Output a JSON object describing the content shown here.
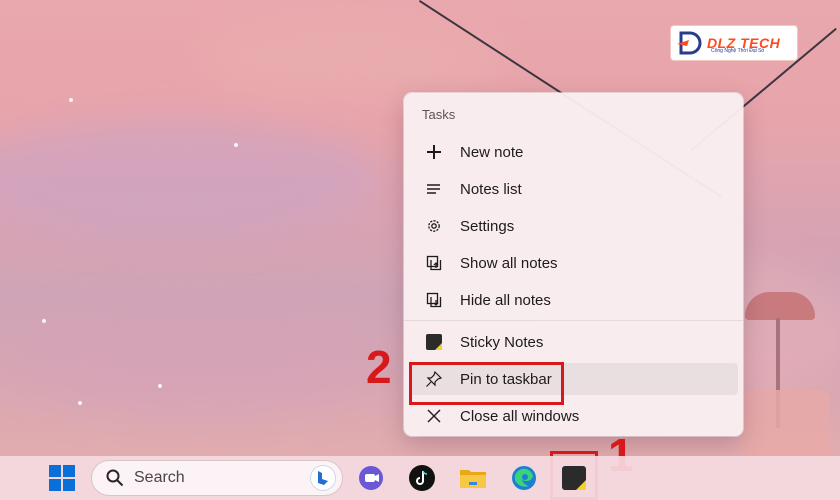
{
  "watermark": {
    "brand": "DLZ TECH",
    "tagline": "Công Nghệ Thời Đại Số"
  },
  "menu": {
    "header": "Tasks",
    "items": [
      {
        "label": "New note",
        "icon": "plus-icon"
      },
      {
        "label": "Notes list",
        "icon": "list-icon"
      },
      {
        "label": "Settings",
        "icon": "gear-icon"
      },
      {
        "label": "Show all notes",
        "icon": "show-windows-icon"
      },
      {
        "label": "Hide all notes",
        "icon": "hide-windows-icon"
      },
      {
        "label": "Sticky Notes",
        "icon": "sticky-notes-app-icon"
      },
      {
        "label": "Pin to taskbar",
        "icon": "pin-icon"
      },
      {
        "label": "Close all windows",
        "icon": "close-icon"
      }
    ]
  },
  "annotations": {
    "step1": "1",
    "step2": "2",
    "color": "#d7191c"
  },
  "taskbar": {
    "search_placeholder": "Search",
    "apps": [
      "windows-start-icon",
      "bing-icon",
      "teams-chat-icon",
      "tiktok-icon",
      "file-explorer-icon",
      "edge-icon",
      "sticky-notes-icon"
    ]
  }
}
